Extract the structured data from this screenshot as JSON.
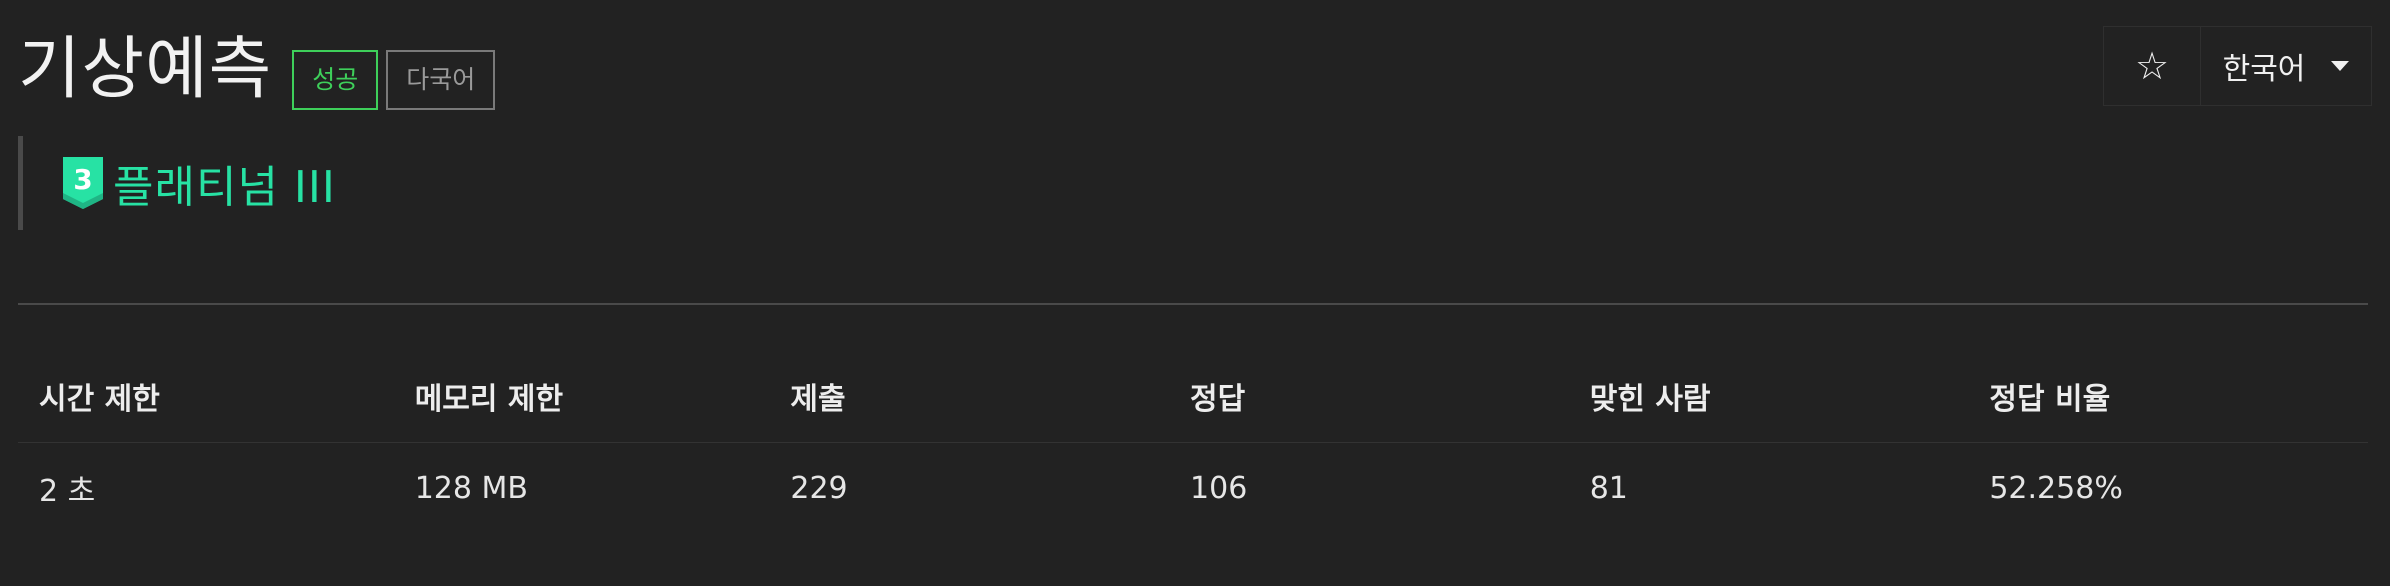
{
  "problem": {
    "title": "기상예측",
    "badges": {
      "success": "성공",
      "multilang": "다국어"
    }
  },
  "controls": {
    "star_icon": "☆",
    "language": "한국어"
  },
  "tier": {
    "level_number": "3",
    "label": "플래티넘 III",
    "color": "#27e2a4"
  },
  "stats": {
    "headers": [
      "시간 제한",
      "메모리 제한",
      "제출",
      "정답",
      "맞힌 사람",
      "정답 비율"
    ],
    "values": [
      "2 초",
      "128 MB",
      "229",
      "106",
      "81",
      "52.258%"
    ]
  },
  "colors": {
    "background": "#222222",
    "success": "#3ecf5a",
    "platinum": "#27e2a4"
  }
}
